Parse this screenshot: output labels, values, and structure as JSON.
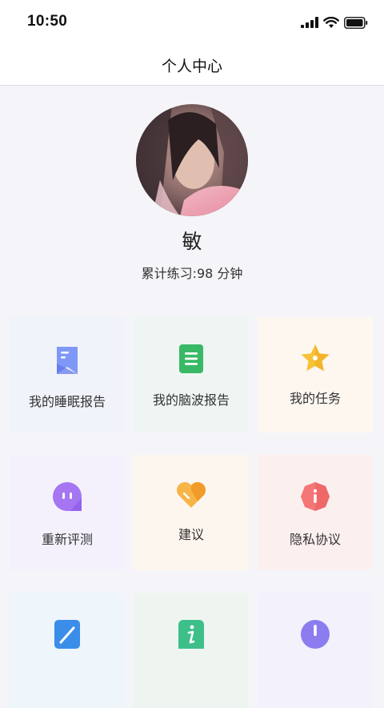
{
  "status_bar": {
    "time": "10:50"
  },
  "header": {
    "title": "个人中心"
  },
  "profile": {
    "name": "敏",
    "practice_text": "累计练习:98 分钟"
  },
  "menu": [
    {
      "label": "我的睡眠报告",
      "icon": "bookmark-report-icon",
      "bg": "#f0f3fa",
      "color": "#6e8cf5"
    },
    {
      "label": "我的脑波报告",
      "icon": "document-list-icon",
      "bg": "#eef5f2",
      "color": "#3dbf6a"
    },
    {
      "label": "我的任务",
      "icon": "star-icon",
      "bg": "#fdf7f0",
      "color": "#f5b72a"
    },
    {
      "label": "重新评测",
      "icon": "chat-bubble-icon",
      "bg": "#f4f1fc",
      "color": "#a36ff0"
    },
    {
      "label": "建议",
      "icon": "heart-icon",
      "bg": "#fdf6ee",
      "color": "#f3a83a"
    },
    {
      "label": "隐私协议",
      "icon": "info-badge-icon",
      "bg": "#fcf0ef",
      "color": "#f26b6b"
    },
    {
      "label": "",
      "icon": "edit-icon",
      "bg": "#eef5fb",
      "color": "#3a8de8"
    },
    {
      "label": "",
      "icon": "info-icon",
      "bg": "#eef5f1",
      "color": "#3dbf8a"
    },
    {
      "label": "",
      "icon": "alert-icon",
      "bg": "#f3f1fb",
      "color": "#8b7cf0"
    }
  ]
}
